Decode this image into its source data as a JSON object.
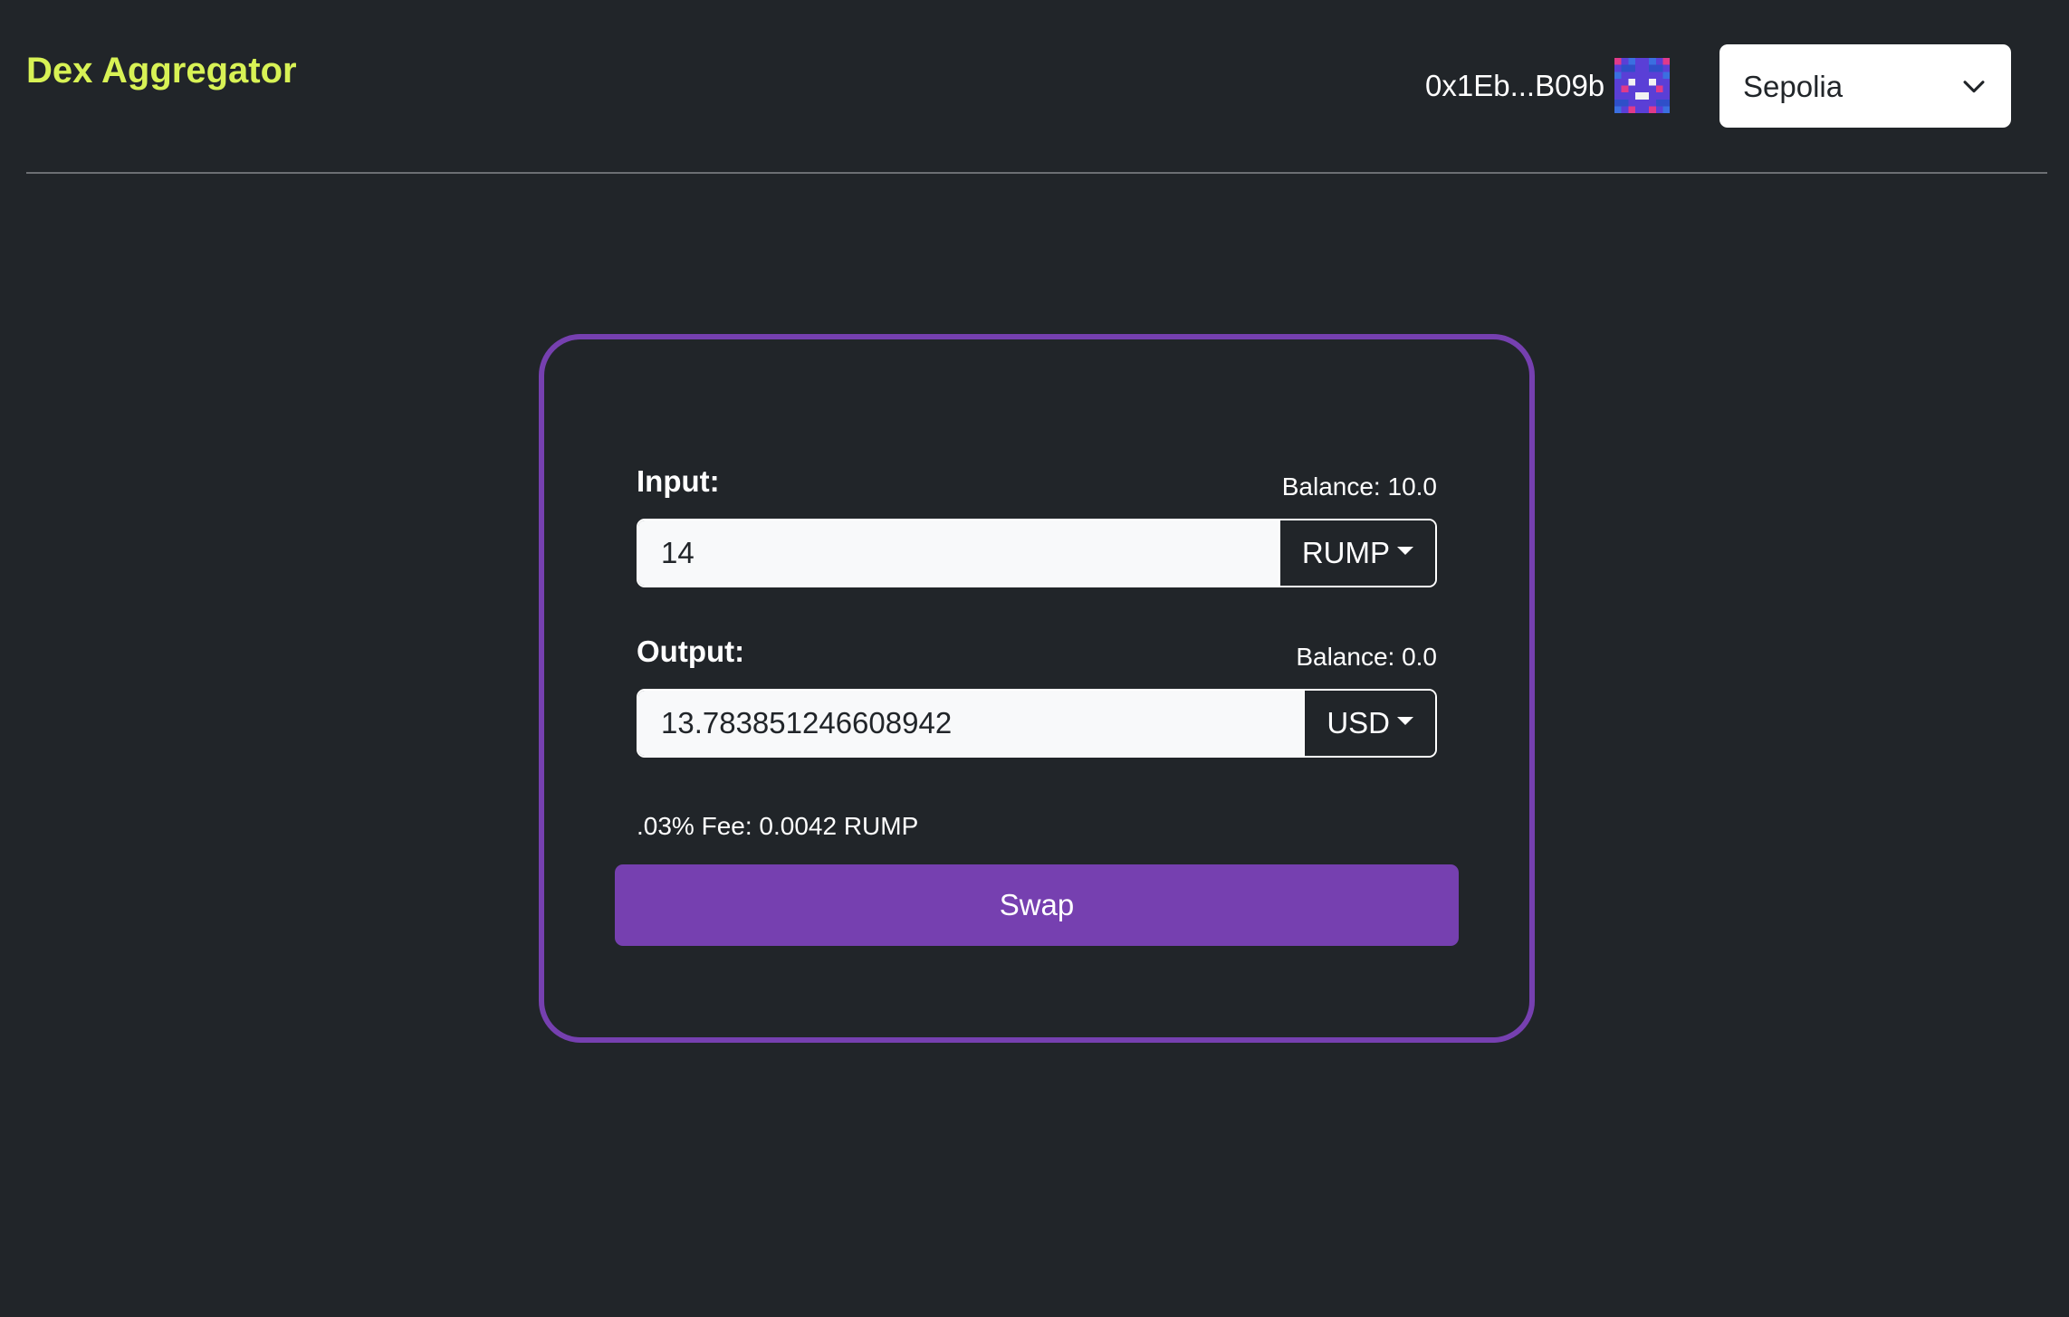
{
  "header": {
    "brand": "Dex Aggregator",
    "account": "0x1Eb...B09b",
    "avatar_icon": "blockie-avatar-icon",
    "network": {
      "selected": "Sepolia",
      "icon": "chevron-down-icon"
    }
  },
  "swap": {
    "input": {
      "label": "Input:",
      "balance": "Balance: 10.0",
      "value": "14",
      "token": "RUMP"
    },
    "output": {
      "label": "Output:",
      "balance": "Balance: 0.0",
      "value": "13.783851246608942",
      "token": "USD"
    },
    "fee": ".03% Fee: 0.0042 RUMP",
    "button_label": "Swap"
  },
  "colors": {
    "background": "#212529",
    "brand": "#d8f255",
    "accent": "#7640b0"
  }
}
